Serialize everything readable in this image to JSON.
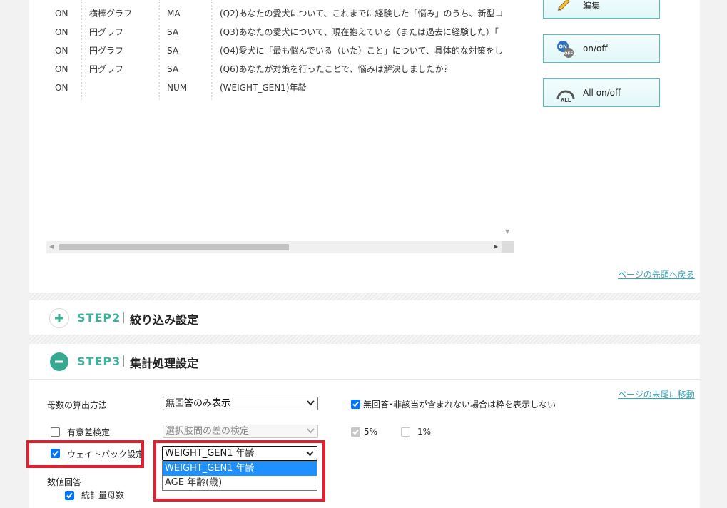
{
  "table": {
    "rows": [
      {
        "status": "ON",
        "graph": "横棒グラフ",
        "type": "MA",
        "question": "(Q2)あなたの愛犬について、これまでに経験した「悩み」のうち、新型コ"
      },
      {
        "status": "ON",
        "graph": "円グラフ",
        "type": "SA",
        "question": "(Q3)あなたの愛犬について、現在抱えている（または過去に経験した）「"
      },
      {
        "status": "ON",
        "graph": "円グラフ",
        "type": "SA",
        "question": "(Q4)愛犬に「最も悩んでいる（いた）こと」について、具体的な対策をし"
      },
      {
        "status": "ON",
        "graph": "円グラフ",
        "type": "SA",
        "question": "(Q6)あなたが対策を行ったことで、悩みは解決しましたか？"
      },
      {
        "status": "ON",
        "graph": "",
        "type": "NUM",
        "question": "(WEIGHT_GEN1)年齢"
      }
    ]
  },
  "side_buttons": {
    "edit": "編集",
    "onoff": "on/off",
    "all_onoff": "All on/off"
  },
  "icons": {
    "onoff_top": "ON",
    "onoff_bottom": "OFF",
    "all": "ALL"
  },
  "links": {
    "back_to_top": "ページの先頭へ戻る",
    "go_to_bottom": "ページの末尾に移動"
  },
  "step2": {
    "label": "STEP2",
    "title": "絞り込み設定"
  },
  "step3": {
    "label": "STEP3",
    "title": "集計処理設定"
  },
  "form": {
    "base_label": "母数の算出方法",
    "base_value": "無回答のみ表示",
    "hide_frame_label": "無回答･非該当が含まれない場合は枠を表示しない",
    "hide_frame_checked": true,
    "sig_label": "有意差検定",
    "sig_checked": false,
    "sig_select": "選択肢間の差の検定",
    "pct5_label": "5%",
    "pct5_checked": true,
    "pct1_label": "1%",
    "pct1_checked": false,
    "weight_label": "ウェイトバック設定",
    "weight_checked": true,
    "weight_value": "WEIGHT_GEN1 年齢",
    "weight_options": [
      "WEIGHT_GEN1 年齢",
      "AGE 年齢(歳)"
    ],
    "numeric_label": "数値回答",
    "stats_label": "統計量母数",
    "stats_checked": true
  },
  "colors": {
    "accent": "#3bb29a",
    "link": "#3aa6b9",
    "highlight_box": "#e4202e",
    "option_highlight": "#1e90ff"
  }
}
